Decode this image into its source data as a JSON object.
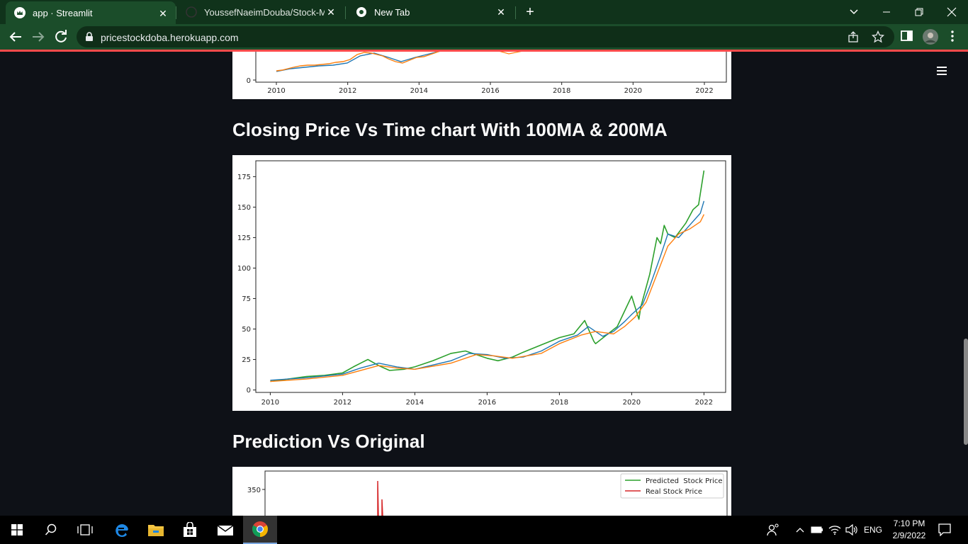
{
  "browser": {
    "tabs": [
      {
        "title": "app · Streamlit"
      },
      {
        "title": "YoussefNaeimDouba/Stock-Mark"
      },
      {
        "title": "New Tab"
      }
    ],
    "url": "pricestockdoba.herokuapp.com"
  },
  "sections": {
    "chart2_title": "Closing Price Vs Time chart With 100MA & 200MA",
    "chart3_title": "Prediction Vs Original"
  },
  "chart_data": [
    {
      "type": "line",
      "x_ticks": [
        "2010",
        "2012",
        "2014",
        "2016",
        "2018",
        "2020",
        "2022"
      ],
      "y_ticks": [
        "0"
      ],
      "colors": {
        "ma": "#1f77b4",
        "price": "#ff7f0e"
      },
      "visible_partial": true
    },
    {
      "type": "line",
      "x_ticks": [
        "2010",
        "2012",
        "2014",
        "2016",
        "2018",
        "2020",
        "2022"
      ],
      "y_ticks": [
        "0",
        "25",
        "50",
        "75",
        "100",
        "125",
        "150",
        "175"
      ],
      "xlim": [
        2009.6,
        2022.6
      ],
      "ylim": [
        -2,
        188
      ],
      "series": [
        {
          "color": "#2ca02c",
          "x": [
            2010.0,
            2010.5,
            2011.0,
            2011.5,
            2012.0,
            2012.3,
            2012.7,
            2013.0,
            2013.3,
            2013.7,
            2014.0,
            2014.5,
            2015.0,
            2015.4,
            2015.7,
            2016.0,
            2016.3,
            2016.7,
            2017.0,
            2017.5,
            2018.0,
            2018.4,
            2018.7,
            2018.95,
            2019.0,
            2019.3,
            2019.6,
            2020.0,
            2020.2,
            2020.25,
            2020.5,
            2020.7,
            2020.8,
            2020.9,
            2021.0,
            2021.2,
            2021.5,
            2021.7,
            2021.85,
            2022.0
          ],
          "y": [
            7,
            9,
            11,
            12,
            14,
            19,
            25,
            20,
            16,
            17,
            19,
            24,
            30,
            32,
            29,
            26,
            24,
            27,
            31,
            37,
            43,
            46,
            57,
            40,
            38,
            45,
            52,
            77,
            58,
            68,
            95,
            125,
            120,
            135,
            128,
            125,
            137,
            148,
            152,
            180
          ]
        },
        {
          "color": "#1f77b4",
          "x": [
            2010.0,
            2011.0,
            2012.0,
            2012.5,
            2013.0,
            2013.5,
            2014.0,
            2015.0,
            2015.5,
            2016.0,
            2016.5,
            2017.0,
            2017.5,
            2018.0,
            2018.5,
            2018.8,
            2019.2,
            2019.5,
            2019.8,
            2020.0,
            2020.3,
            2020.5,
            2020.8,
            2021.0,
            2021.3,
            2021.6,
            2021.9,
            2022.0
          ],
          "y": [
            8,
            10,
            13,
            18,
            22,
            19,
            17,
            24,
            30,
            29,
            26,
            27,
            32,
            40,
            45,
            52,
            44,
            48,
            56,
            62,
            70,
            85,
            110,
            128,
            125,
            135,
            145,
            155
          ]
        },
        {
          "color": "#ff7f0e",
          "x": [
            2010.0,
            2011.0,
            2012.0,
            2013.0,
            2013.5,
            2014.0,
            2015.0,
            2015.7,
            2016.2,
            2016.7,
            2017.5,
            2018.0,
            2018.6,
            2019.0,
            2019.5,
            2019.8,
            2020.1,
            2020.4,
            2020.7,
            2021.0,
            2021.3,
            2021.6,
            2021.9,
            2022.0
          ],
          "y": [
            7,
            9,
            12,
            20,
            18,
            17,
            22,
            29,
            28,
            26,
            30,
            38,
            45,
            48,
            46,
            52,
            60,
            72,
            95,
            118,
            128,
            132,
            138,
            144
          ]
        }
      ]
    },
    {
      "type": "line",
      "y_ticks": [
        "350"
      ],
      "legend": [
        "Predicted  Stock Price",
        "Real Stock Price"
      ],
      "legend_colors": [
        "#2ca02c",
        "#d62728"
      ],
      "legend_position": "top-right",
      "visible_partial": true
    }
  ],
  "taskbar": {
    "time": "7:10 PM",
    "date": "2/9/2022",
    "language": "ENG"
  }
}
